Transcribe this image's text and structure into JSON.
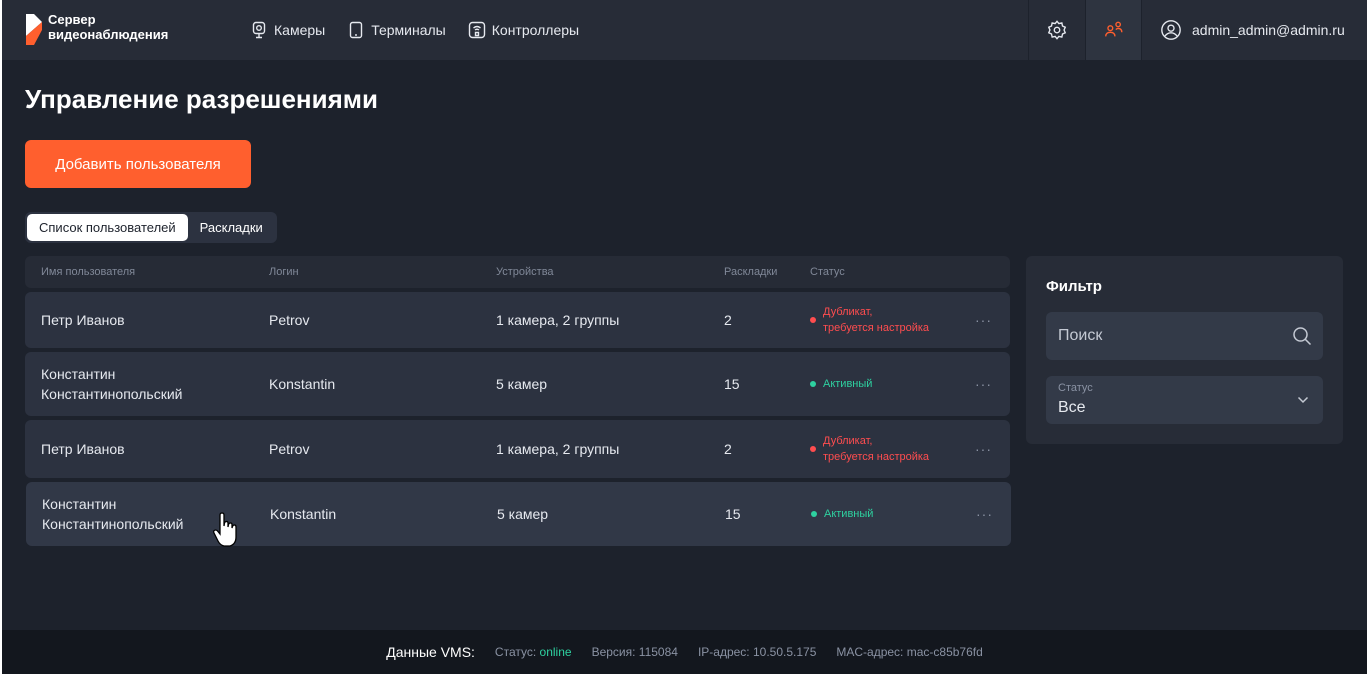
{
  "app": {
    "logo_line1": "Сервер",
    "logo_line2": "видеонаблюдения",
    "accent_color": "#ff5f2e"
  },
  "nav": {
    "items": [
      {
        "label": "Камеры",
        "icon": "camera-icon"
      },
      {
        "label": "Терминалы",
        "icon": "tablet-icon"
      },
      {
        "label": "Контроллеры",
        "icon": "controller-icon"
      }
    ]
  },
  "header": {
    "settings_icon": "gear-icon",
    "users_icon": "users-icon",
    "user_email": "admin_admin@admin.ru"
  },
  "page": {
    "title": "Управление разрешениями",
    "add_button": "Добавить пользователя",
    "tabs": [
      {
        "label": "Список пользователей",
        "active": true
      },
      {
        "label": "Раскладки",
        "active": false
      }
    ]
  },
  "table": {
    "columns": [
      "Имя пользователя",
      "Логин",
      "Устройства",
      "Раскладки",
      "Статус"
    ],
    "rows": [
      {
        "name_line1": "Петр Иванов",
        "name_line2": "",
        "login": "Petrov",
        "devices": "1 камера, 2 группы",
        "layouts": "2",
        "status_line1": "Дубликат,",
        "status_line2": "требуется настройка",
        "status_color": "#ff4d4f"
      },
      {
        "name_line1": "Константин",
        "name_line2": "Константинопольский",
        "login": "Konstantin",
        "devices": "5 камер",
        "layouts": "15",
        "status_line1": "Активный",
        "status_line2": "",
        "status_color": "#2ed1a0"
      },
      {
        "name_line1": "Петр Иванов",
        "name_line2": "",
        "login": "Petrov",
        "devices": "1 камера, 2 группы",
        "layouts": "2",
        "status_line1": "Дубликат,",
        "status_line2": "требуется настройка",
        "status_color": "#ff4d4f"
      },
      {
        "name_line1": "Константин",
        "name_line2": "Константинопольский",
        "login": "Konstantin",
        "devices": "5 камер",
        "layouts": "15",
        "status_line1": "Активный",
        "status_line2": "",
        "status_color": "#2ed1a0"
      }
    ],
    "more_label": "···"
  },
  "filter": {
    "title": "Фильтр",
    "search_placeholder": "Поиск",
    "status_label": "Статус",
    "status_value": "Все"
  },
  "footer": {
    "main": "Данные VMS:",
    "status_label": "Статус:",
    "status_value": "online",
    "version": "Версия: 115084",
    "ip": "IP-адрес: 10.50.5.175",
    "mac": "MAC-адрес: mac-c85b76fd"
  }
}
